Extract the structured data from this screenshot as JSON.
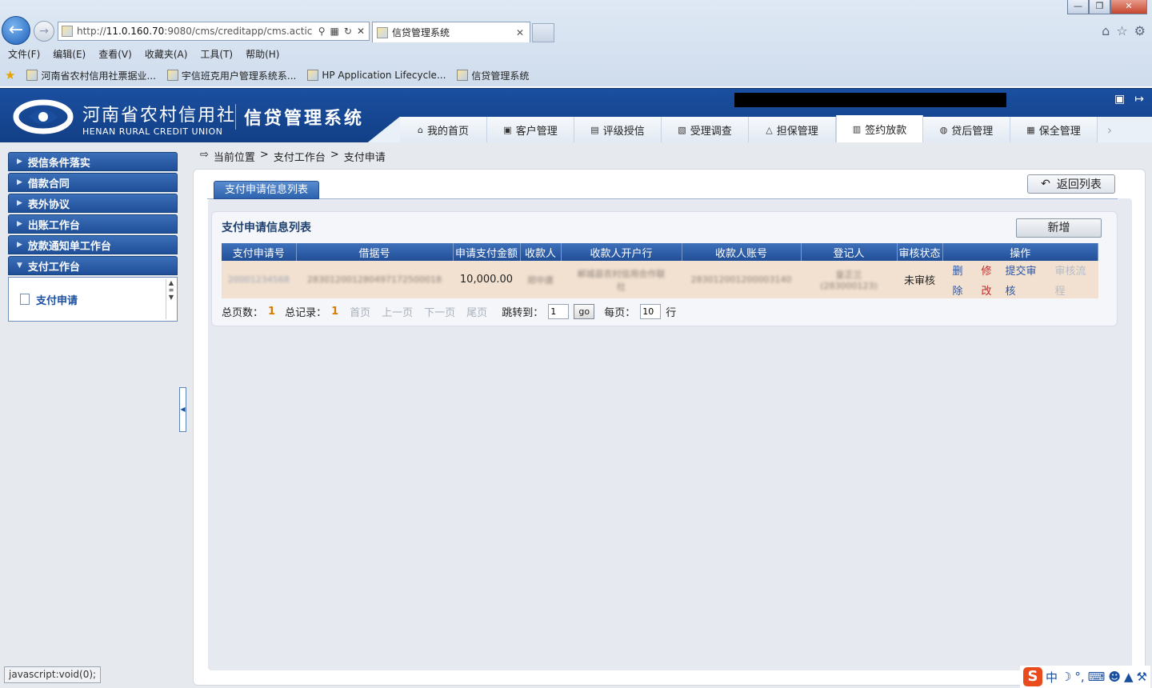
{
  "browser": {
    "window_buttons": {
      "min": "—",
      "max": "❐",
      "close": "✕"
    },
    "address_normal": "http://",
    "address_host": "11.0.160.70",
    "address_rest": ":9080/cms/creditapp/cms.actic",
    "tab_title": "信贷管理系统",
    "tab_close": "✕",
    "menu": [
      "文件(F)",
      "编辑(E)",
      "查看(V)",
      "收藏夹(A)",
      "工具(T)",
      "帮助(H)"
    ],
    "favorites": [
      "河南省农村信用社票据业...",
      "宇信班克用户管理系统系...",
      "HP Application Lifecycle...",
      "信贷管理系统"
    ]
  },
  "header": {
    "brand_cn": "河南省农村信用社",
    "brand_en": "HENAN RURAL CREDIT UNION",
    "system_name": "信贷管理系统"
  },
  "nav": [
    {
      "label": "我的首页",
      "icon": "⌂"
    },
    {
      "label": "客户管理",
      "icon": "▣"
    },
    {
      "label": "评级授信",
      "icon": "▤"
    },
    {
      "label": "受理调查",
      "icon": "▧"
    },
    {
      "label": "担保管理",
      "icon": "△"
    },
    {
      "label": "签约放款",
      "icon": "▥",
      "active": true
    },
    {
      "label": "贷后管理",
      "icon": "◍"
    },
    {
      "label": "保全管理",
      "icon": "▦"
    }
  ],
  "sidebar": {
    "items": [
      "授信条件落实",
      "借款合同",
      "表外协议",
      "出账工作台",
      "放款通知单工作台",
      "支付工作台"
    ],
    "sub_item": "支付申请"
  },
  "breadcrumb": {
    "prefix": "当前位置",
    "sep": ">",
    "level1": "支付工作台",
    "level2": "支付申请"
  },
  "main": {
    "tab_label": "支付申请信息列表",
    "back_button": "返回列表",
    "list_title": "支付申请信息列表",
    "add_button": "新增",
    "columns": [
      "支付申请号",
      "借据号",
      "申请支付金额",
      "收款人",
      "收款人开户行",
      "收款人账号",
      "登记人",
      "审核状态",
      "操作"
    ],
    "row": {
      "apply_no": "20001234568",
      "loan_no": "283012001280497172500018",
      "amount": "10,000.00",
      "payee": "郑中唐",
      "bank_line1": "郸城县农村信用合作联",
      "bank_line2": "社",
      "account": "283012001200003140",
      "registrar_line1": "皇正兰",
      "registrar_line2": "(283000123)",
      "status": "未审核",
      "ops": {
        "del1": "删",
        "del2": "除",
        "mod1": "修",
        "mod2": "改",
        "sub1": "提交审",
        "sub2": "核",
        "flow1": "审核流",
        "flow2": "程"
      }
    },
    "pager": {
      "total_pages_label": "总页数：",
      "total_pages": "1",
      "total_records_label": "总记录：",
      "total_records": "1",
      "first": "首页",
      "prev": "上一页",
      "next": "下一页",
      "last": "尾页",
      "jump_label": "跳转到：",
      "jump_value": "1",
      "go": "go",
      "per_page_label": "每页：",
      "per_page_value": "10",
      "per_page_unit": "行"
    }
  },
  "statusbar": "javascript:void(0);",
  "ime": {
    "logo": "S",
    "mode": "中"
  }
}
